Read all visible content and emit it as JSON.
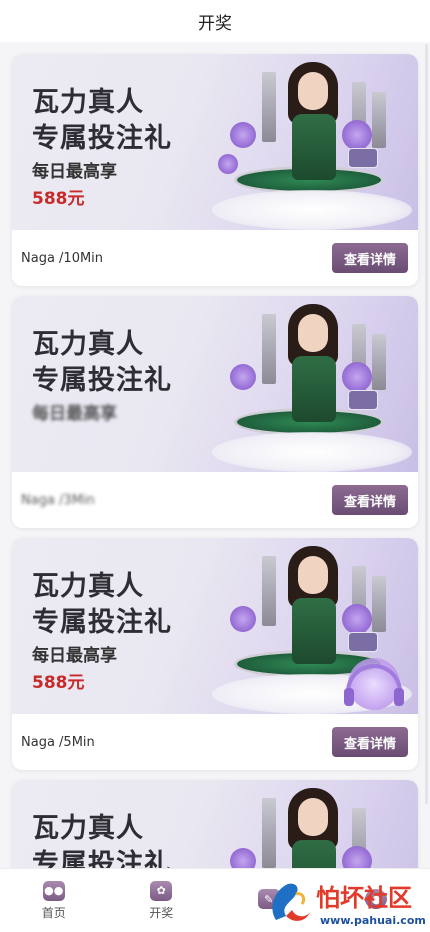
{
  "header": {
    "title": "开奖"
  },
  "cards": [
    {
      "banner": {
        "line1": "瓦力真人",
        "line2": "专属投注礼",
        "line3": "每日最高享",
        "line4": "588元"
      },
      "name": "Naga /10Min",
      "button": "查看详情"
    },
    {
      "banner": {
        "line1": "瓦力真人",
        "line2": "专属投注礼",
        "line3": "每日最高享",
        "line4": ""
      },
      "name": "Naga /3Min",
      "button": "查看详情"
    },
    {
      "banner": {
        "line1": "瓦力真人",
        "line2": "专属投注礼",
        "line3": "每日最高享",
        "line4": "588元"
      },
      "name": "Naga /5Min",
      "button": "查看详情"
    },
    {
      "banner": {
        "line1": "瓦力真人",
        "line2": "专属投注礼",
        "line3": "",
        "line4": ""
      },
      "name": "",
      "button": ""
    }
  ],
  "tabs": [
    {
      "label": "首页",
      "icon": "gamepad-icon"
    },
    {
      "label": "开奖",
      "icon": "flower-icon"
    },
    {
      "label": "",
      "icon": "edit-icon"
    },
    {
      "label": "",
      "icon": "user-icon"
    }
  ],
  "watermark": {
    "name": "怕坏社区",
    "url": "www.pahuai.com"
  },
  "colors": {
    "button": "#6a4d74",
    "price": "#c62a2a",
    "background": "#f5f5f7"
  }
}
